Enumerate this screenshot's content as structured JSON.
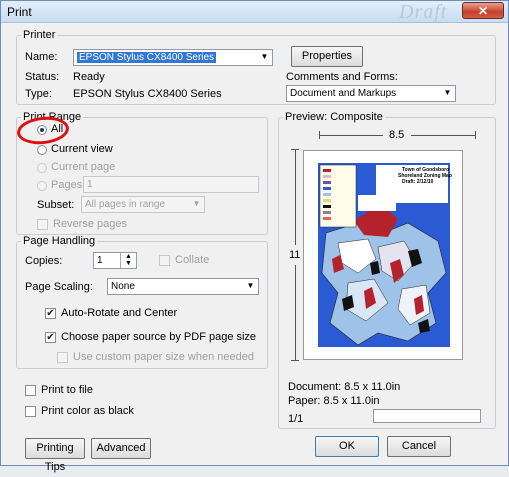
{
  "window": {
    "title": "Print",
    "bg_watermark": "Draft"
  },
  "printer": {
    "group_label": "Printer",
    "name_label": "Name:",
    "name_value": "EPSON Stylus CX8400 Series",
    "status_label": "Status:",
    "status_value": "Ready",
    "type_label": "Type:",
    "type_value": "EPSON Stylus CX8400 Series",
    "properties_button": "Properties",
    "comments_label": "Comments and Forms:",
    "comments_value": "Document and Markups"
  },
  "print_range": {
    "group_label": "Print Range",
    "all": "All",
    "current_view": "Current view",
    "current_page": "Current page",
    "pages": "Pages",
    "pages_value": "1",
    "subset_label": "Subset:",
    "subset_value": "All pages in range",
    "reverse": "Reverse pages",
    "selected": "all"
  },
  "page_handling": {
    "group_label": "Page Handling",
    "copies_label": "Copies:",
    "copies_value": "1",
    "collate": "Collate",
    "scaling_label": "Page Scaling:",
    "scaling_value": "None",
    "auto_rotate": "Auto-Rotate and Center",
    "paper_source": "Choose paper source by PDF page size",
    "custom_paper": "Use custom paper size when needed"
  },
  "options": {
    "print_to_file": "Print to file",
    "print_color_black": "Print color as black"
  },
  "preview": {
    "group_label": "Preview: Composite",
    "width_label": "8.5",
    "height_label": "11",
    "document_size": "Document: 8.5 x 11.0in",
    "paper_size": "Paper: 8.5 x 11.0in",
    "page_counter": "1/1",
    "map_title_1": "Town of Goodsboro",
    "map_title_2": "Shoreland Zoning Map",
    "map_title_3": "Draft: 2/12/10"
  },
  "buttons": {
    "printing_tips": "Printing Tips",
    "advanced": "Advanced",
    "ok": "OK",
    "cancel": "Cancel"
  },
  "colors": {
    "highlight": "#3178d6",
    "annotation_red": "#e01010",
    "map_blue": "#2b5bd4"
  }
}
